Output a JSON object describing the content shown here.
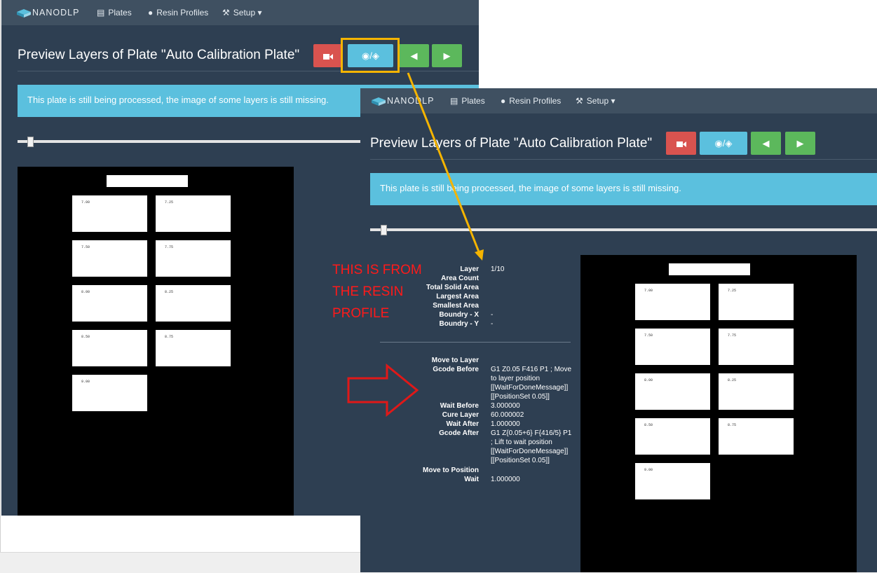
{
  "nav": {
    "brand": "NANODLP",
    "items": [
      {
        "icon": "plates-icon",
        "label": "Plates"
      },
      {
        "icon": "resin-drop-icon",
        "label": "Resin Profiles"
      },
      {
        "icon": "wrench-icon",
        "label": "Setup"
      }
    ]
  },
  "page": {
    "title": "Preview Layers of Plate \"Auto Calibration Plate\"",
    "toggle_label": "/",
    "alert": "This plate is still being processed, the image of some layers is still missing."
  },
  "tiles": [
    "7.00",
    "7.25",
    "7.50",
    "7.75",
    "8.00",
    "8.25",
    "8.50",
    "8.75",
    "9.00"
  ],
  "info": {
    "layer_stats": [
      {
        "label": "Layer",
        "value": "1/10"
      },
      {
        "label": "Area Count",
        "value": ""
      },
      {
        "label": "Total Solid Area",
        "value": ""
      },
      {
        "label": "Largest Area",
        "value": ""
      },
      {
        "label": "Smallest Area",
        "value": ""
      },
      {
        "label": "Boundry - X",
        "value": "-"
      },
      {
        "label": "Boundry - Y",
        "value": "-"
      }
    ],
    "profile_steps": [
      {
        "label": "Move to Layer",
        "value": ""
      },
      {
        "label": "Gcode Before",
        "value": "G1 Z0.05 F416 P1 ; Move to layer position [[WaitForDoneMessage]] [[PositionSet 0.05]]"
      },
      {
        "label": "Wait Before",
        "value": "3.000000"
      },
      {
        "label": "Cure Layer",
        "value": "60.000002"
      },
      {
        "label": "Wait After",
        "value": "1.000000"
      },
      {
        "label": "Gcode After",
        "value": "G1 Z{0.05+6} F{416/5} P1 ; Lift to wait position [[WaitForDoneMessage]] [[PositionSet 0.05]]"
      },
      {
        "label": "Move to Position",
        "value": ""
      },
      {
        "label": "Wait",
        "value": "1.000000"
      }
    ]
  },
  "annotation": {
    "text": "THIS IS FROM THE RESIN PROFILE"
  },
  "colors": {
    "page_bg": "#2e3f52",
    "navbar": "#3f5061",
    "info_blue": "#5bc0de",
    "danger_red": "#d9534f",
    "success_green": "#5cb85c",
    "highlight_yellow": "#f5b400",
    "annotation_red": "#ff1a1a"
  }
}
